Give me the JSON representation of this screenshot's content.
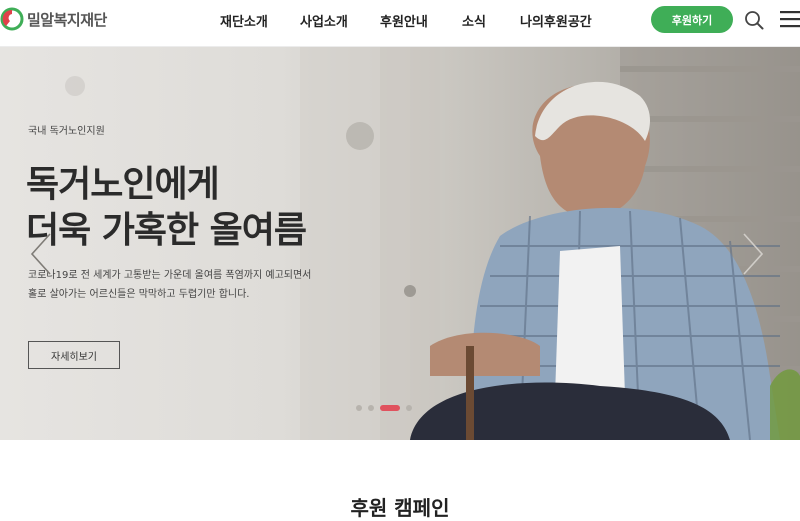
{
  "header": {
    "logo_text": "밀알복지재단",
    "nav": [
      "재단소개",
      "사업소개",
      "후원안내",
      "소식",
      "나의후원공간"
    ],
    "donate_label": "후원하기"
  },
  "hero": {
    "category": "국내 독거노인지원",
    "title_line1": "독거노인에게",
    "title_line2": "더욱 가혹한 올여름",
    "desc_line1": "코로나19로 전 세계가 고통받는 가운데 올여름 폭염까지 예고되면서",
    "desc_line2": "홀로 살아가는 어르신들은 막막하고 두렵기만 합니다.",
    "more_label": "자세히보기",
    "slides": 4,
    "active_slide": 3
  },
  "section": {
    "title": "후원 캠페인"
  },
  "colors": {
    "accent_green": "#3fae57",
    "logo_red": "#e0404a",
    "dot_active": "#e0525e"
  }
}
